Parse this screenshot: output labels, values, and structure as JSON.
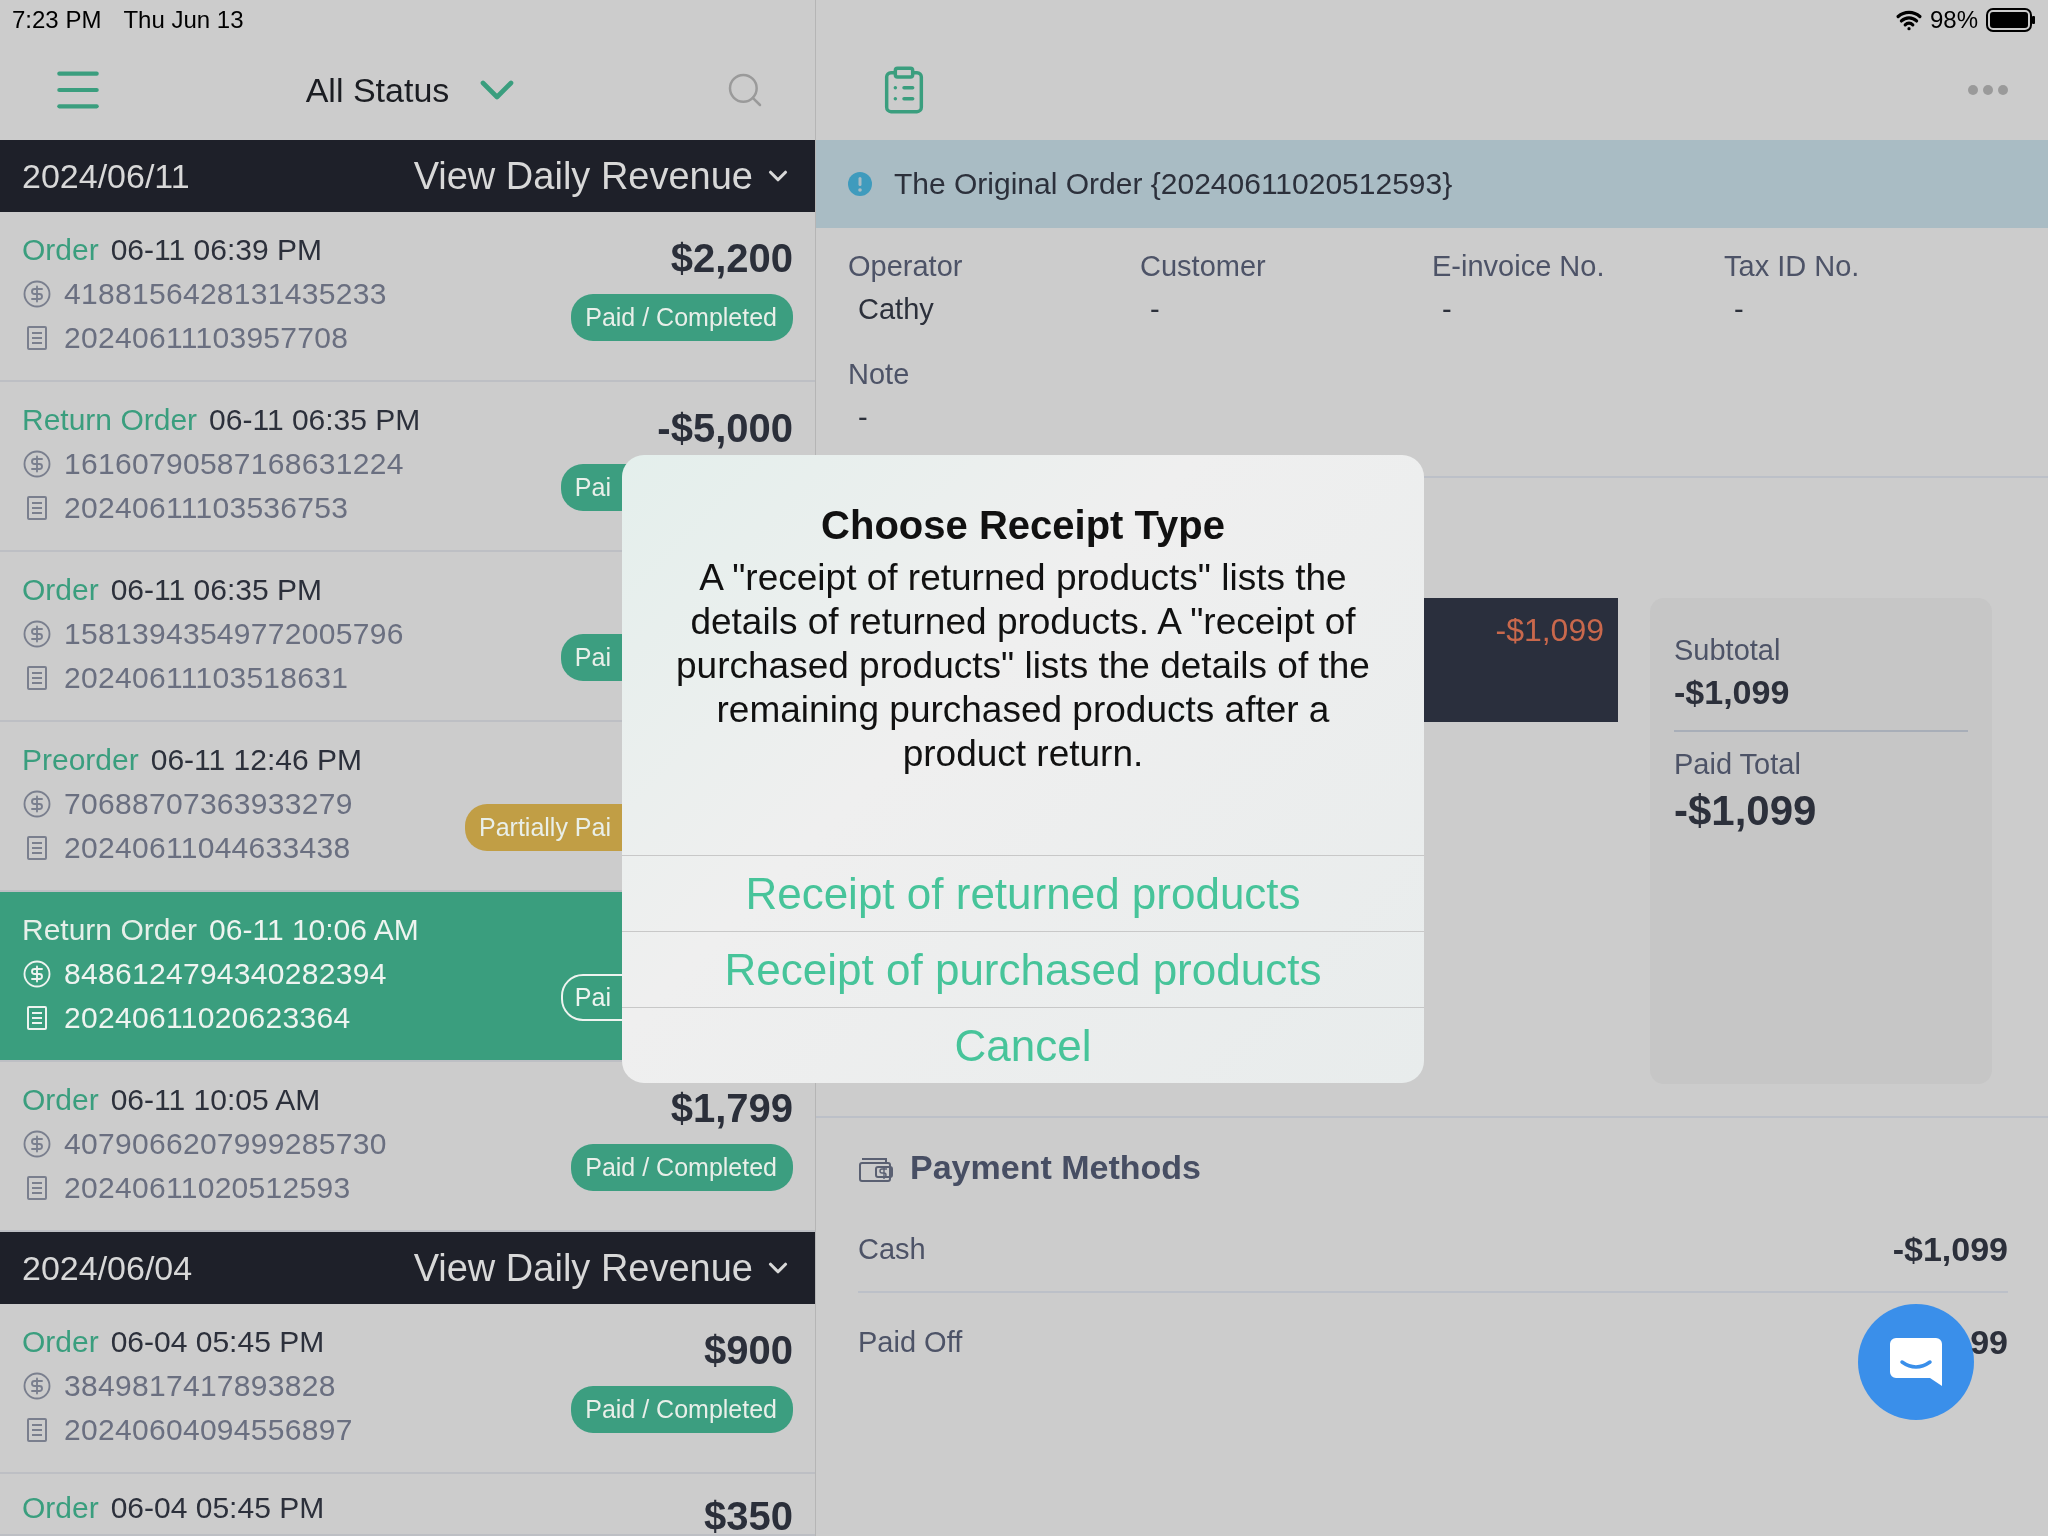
{
  "status_bar": {
    "time": "7:23 PM",
    "date": "Thu Jun 13",
    "battery": "98%"
  },
  "list_header": {
    "filter": "All Status"
  },
  "groups": [
    {
      "date": "2024/06/11",
      "action": "View Daily Revenue",
      "orders": [
        {
          "type": "Order",
          "datetime": "06-11 06:39 PM",
          "payment_no": "4188156428131435233",
          "order_no": "20240611103957708",
          "amount": "$2,200",
          "badge": {
            "text": "Paid / Completed",
            "kind": "paid"
          },
          "selected": false
        },
        {
          "type": "Return Order",
          "datetime": "06-11 06:35 PM",
          "payment_no": "16160790587168631224",
          "order_no": "20240611103536753",
          "amount": "-$5,000",
          "badge": {
            "text": "Pai",
            "kind": "paid"
          },
          "covered": true,
          "selected": false
        },
        {
          "type": "Order",
          "datetime": "06-11 06:35 PM",
          "payment_no": "15813943549772005796",
          "order_no": "20240611103518631",
          "badge": {
            "text": "Pai",
            "kind": "paid"
          },
          "covered": true,
          "selected": false
        },
        {
          "type": "Preorder",
          "datetime": "06-11 12:46 PM",
          "payment_no": "70688707363933279",
          "order_no": "20240611044633438",
          "badge": {
            "text": "Partially Pai",
            "kind": "partial"
          },
          "covered": true,
          "selected": false
        },
        {
          "type": "Return Order",
          "datetime": "06-11 10:06 AM",
          "payment_no": "8486124794340282394",
          "order_no": "20240611020623364",
          "badge": {
            "text": "Pai",
            "kind": "paid"
          },
          "covered": true,
          "selected": true
        },
        {
          "type": "Order",
          "datetime": "06-11 10:05 AM",
          "payment_no": "4079066207999285730",
          "order_no": "20240611020512593",
          "amount": "$1,799",
          "badge": {
            "text": "Paid / Completed",
            "kind": "paid"
          },
          "selected": false
        }
      ]
    },
    {
      "date": "2024/06/04",
      "action": "View Daily Revenue",
      "orders": [
        {
          "type": "Order",
          "datetime": "06-04 05:45 PM",
          "payment_no": "3849817417893828",
          "order_no": "20240604094556897",
          "amount": "$900",
          "badge": {
            "text": "Paid / Completed",
            "kind": "paid"
          },
          "selected": false
        },
        {
          "type": "Order",
          "datetime": "06-04 05:45 PM",
          "amount": "$350",
          "selected": false
        }
      ]
    }
  ],
  "detail": {
    "banner": "The Original Order {20240611020512593}",
    "fields": [
      {
        "label": "Operator",
        "value": "Cathy"
      },
      {
        "label": "Customer",
        "value": "-"
      },
      {
        "label": "E-invoice No.",
        "value": "-"
      },
      {
        "label": "Tax ID No.",
        "value": "-"
      }
    ],
    "note": {
      "label": "Note",
      "value": "-"
    },
    "item_amount": "-$1,099",
    "summary": [
      {
        "label": "Subtotal",
        "value": "-$1,099"
      },
      {
        "label": "Paid Total",
        "value": "-$1,099"
      }
    ],
    "payment": {
      "title": "Payment Methods",
      "rows": [
        {
          "label": "Cash",
          "value": "-$1,099"
        },
        {
          "label": "Paid Off",
          "value": "99"
        }
      ]
    }
  },
  "dialog": {
    "title": "Choose Receipt Type",
    "message": "A \"receipt of returned products\" lists the details of returned products. A \"receipt of purchased products\" lists the details of the remaining purchased products after a product return.",
    "actions": [
      {
        "label": "Receipt of returned products"
      },
      {
        "label": "Receipt of purchased products"
      },
      {
        "label": "Cancel"
      }
    ]
  }
}
